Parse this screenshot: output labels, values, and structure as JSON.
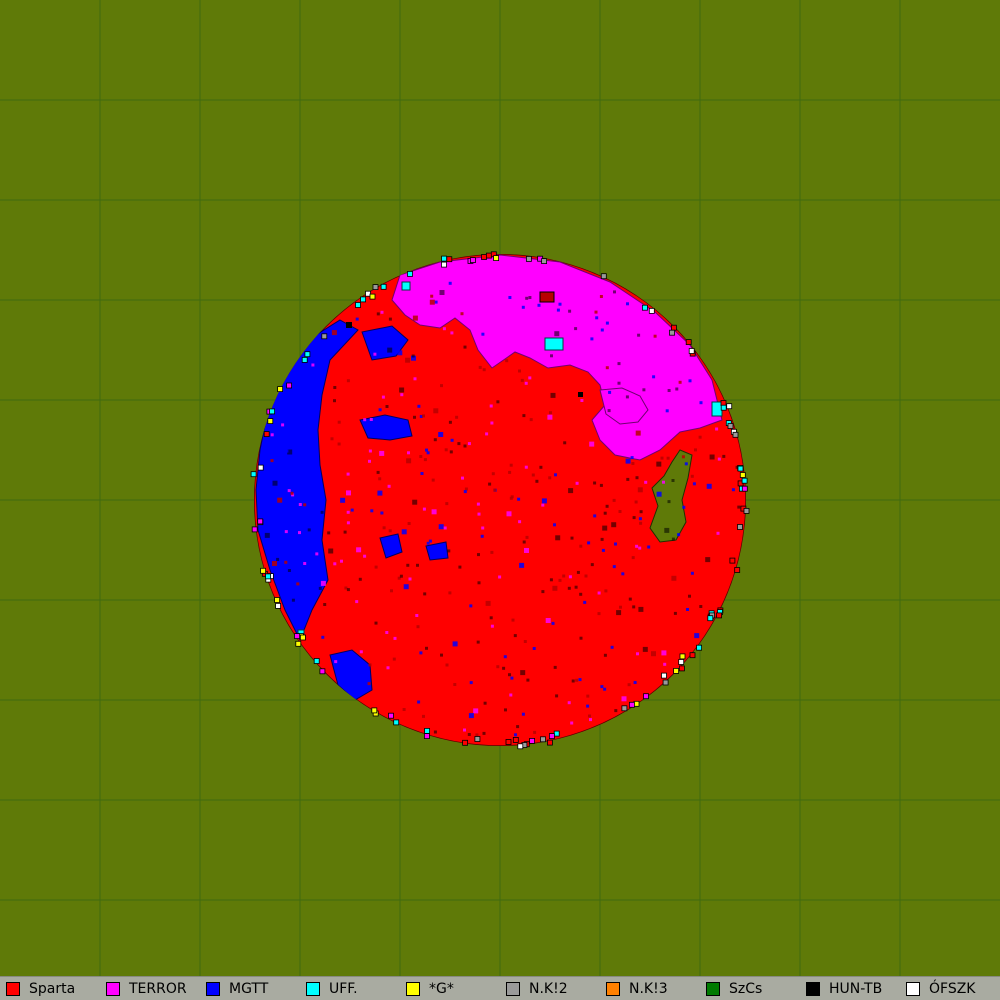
{
  "map": {
    "background": "#5f7a08",
    "grid_color": "#3f6a10",
    "grid_cells": 10,
    "regions_colors": {
      "Sparta": "#ff0000",
      "TERROR": "#ff00ff",
      "MGTT": "#0000ff",
      "UFF.": "#00ffff",
      "*G*": "#ffff00",
      "N.K!2": "#9a9a9a",
      "N.K!3": "#ff8000",
      "SzCs": "#007a00",
      "HUN-TB": "#000000",
      "ÓFSZK": "#ffffff"
    }
  },
  "legend": [
    {
      "label": "Sparta",
      "color": "#ff0000"
    },
    {
      "label": "TERROR",
      "color": "#ff00ff"
    },
    {
      "label": "MGTT",
      "color": "#0000ff"
    },
    {
      "label": "UFF.",
      "color": "#00ffff"
    },
    {
      "label": "*G*",
      "color": "#ffff00"
    },
    {
      "label": "N.K!2",
      "color": "#9a9a9a"
    },
    {
      "label": "N.K!3",
      "color": "#ff8000"
    },
    {
      "label": "SzCs",
      "color": "#007a00"
    },
    {
      "label": "HUN-TB",
      "color": "#000000"
    },
    {
      "label": "ÓFSZK",
      "color": "#ffffff"
    }
  ]
}
